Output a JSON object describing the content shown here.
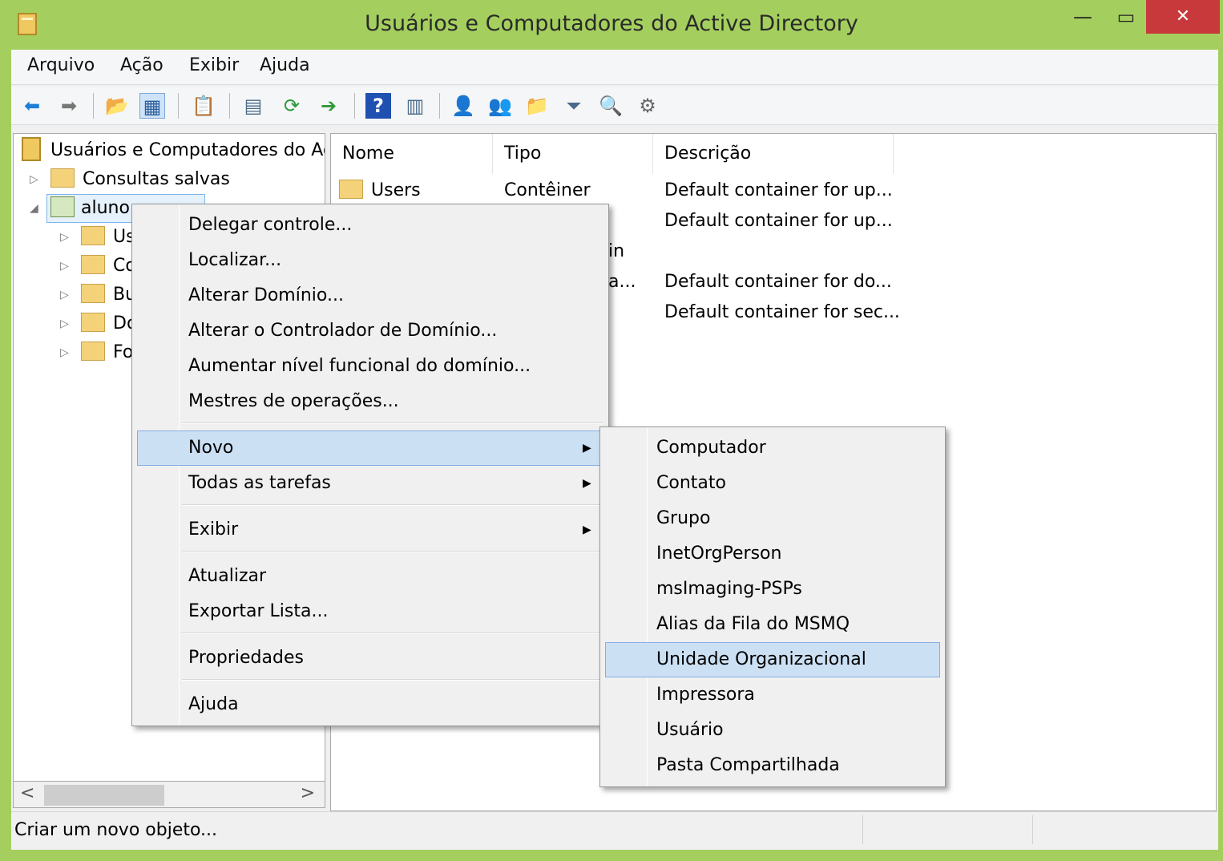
{
  "window": {
    "title": "Usuários e Computadores do Active Directory",
    "minimize_glyph": "—",
    "maximize_glyph": "▭",
    "close_glyph": "✕"
  },
  "menubar": [
    "Arquivo",
    "Ação",
    "Exibir",
    "Ajuda"
  ],
  "toolbar": {
    "icons": [
      "back-arrow-icon",
      "forward-arrow-icon",
      "up-folder-icon",
      "show-hide-console-tree-icon",
      "clipboard-icon",
      "properties-icon",
      "refresh-icon",
      "export-list-icon",
      "help-icon",
      "view-icon",
      "new-user-icon",
      "new-group-icon",
      "new-ou-icon",
      "filter-icon",
      "find-icon",
      "add-to-group-icon"
    ],
    "glyphs": [
      "⬅",
      "➡",
      "📂",
      "▦",
      "📋",
      "▤",
      "⟳",
      "➔",
      "?",
      "▥",
      "👤",
      "👥",
      "📁",
      "⏷",
      "🔍",
      "⚙"
    ]
  },
  "tree": {
    "root": "Usuários e Computadores do Active Directory",
    "saved_queries": "Consultas salvas",
    "domain": "aluno",
    "children": [
      "Us",
      "Co",
      "Bu",
      "Do",
      "Fo"
    ],
    "expander_collapsed": "▷",
    "expander_expanded": "◢"
  },
  "scrollbar": {
    "left": "<",
    "right": ">"
  },
  "list": {
    "columns": [
      "Nome",
      "Tipo",
      "Descrição"
    ],
    "rows": [
      {
        "name": "Users",
        "type": "Contêiner",
        "desc": "Default container for up..."
      },
      {
        "name": "",
        "type": "",
        "desc": "Default container for up..."
      },
      {
        "name": "",
        "type": "in",
        "desc": ""
      },
      {
        "name": "",
        "type": "a...",
        "desc": "Default container for do..."
      },
      {
        "name": "",
        "type": "",
        "desc": "Default container for sec..."
      }
    ]
  },
  "context_menu": {
    "items": [
      "Delegar controle...",
      "Localizar...",
      "Alterar Domínio...",
      "Alterar o Controlador de Domínio...",
      "Aumentar nível funcional do domínio...",
      "Mestres de operações...",
      "Novo",
      "Todas as tarefas",
      "Exibir",
      "Atualizar",
      "Exportar Lista...",
      "Propriedades",
      "Ajuda"
    ],
    "submenu_arrow": "▶",
    "highlighted": "Novo"
  },
  "submenu": {
    "items": [
      "Computador",
      "Contato",
      "Grupo",
      "InetOrgPerson",
      "msImaging-PSPs",
      "Alias da Fila do MSMQ",
      "Unidade Organizacional",
      "Impressora",
      "Usuário",
      "Pasta Compartilhada"
    ],
    "highlighted": "Unidade Organizacional"
  },
  "status": {
    "text": "Criar um novo objeto..."
  },
  "colors": {
    "frame": "#a4cf5e",
    "close": "#c7393a",
    "highlight": "#cce0f4",
    "highlight_border": "#84aee3"
  }
}
